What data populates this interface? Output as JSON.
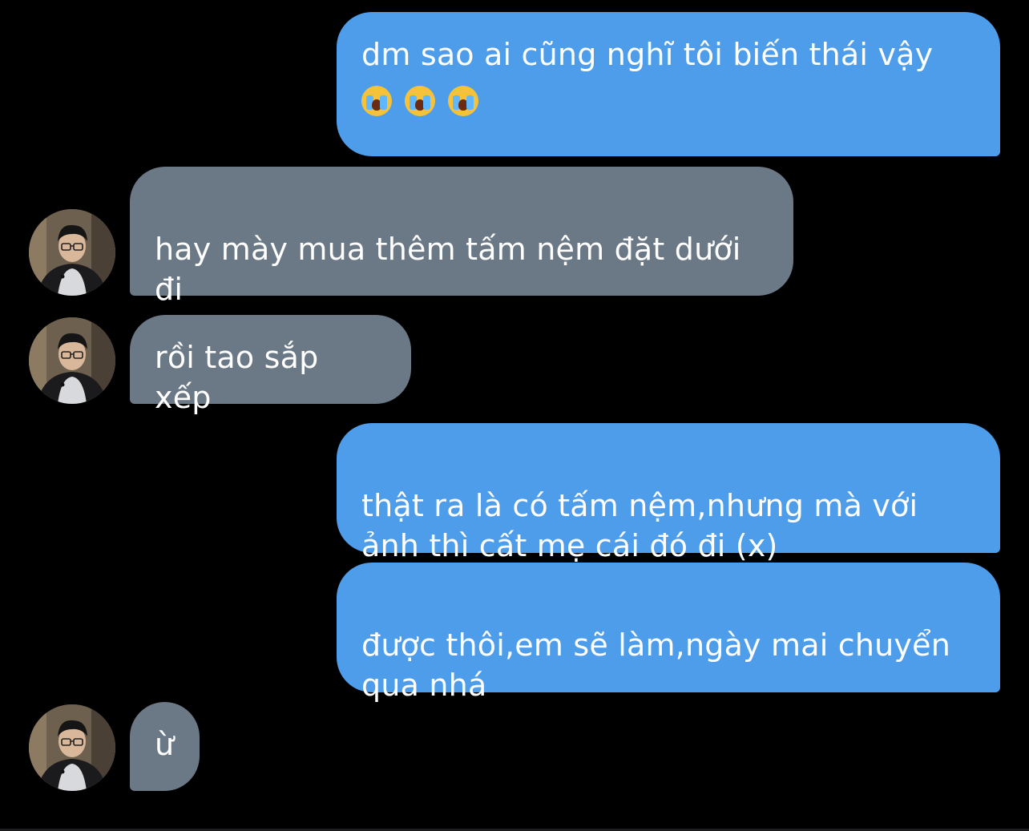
{
  "messages": [
    {
      "side": "out",
      "text": "dm sao ai cũng nghĩ tôi biến thái vậy",
      "emoji": [
        "loudly-crying-face",
        "loudly-crying-face",
        "loudly-crying-face"
      ]
    },
    {
      "side": "in",
      "text": "hay mày mua thêm tấm nệm đặt dưới\nđi"
    },
    {
      "side": "in",
      "text": "rồi tao sắp xếp"
    },
    {
      "side": "out",
      "text": "thật ra là có tấm nệm,nhưng mà với\nảnh thì cất mẹ cái đó đi (x)"
    },
    {
      "side": "out",
      "text": "được thôi,em sẽ làm,ngày mai chuyển\nqua nhá"
    },
    {
      "side": "in",
      "text": "ừ"
    }
  ],
  "colors": {
    "background": "#000000",
    "outgoing_bubble": "#4e9deb",
    "incoming_bubble": "#6b7886",
    "text": "#ffffff"
  },
  "icons": {
    "avatar": "contact-avatar-photo",
    "emoji": "loudly-crying-face"
  }
}
